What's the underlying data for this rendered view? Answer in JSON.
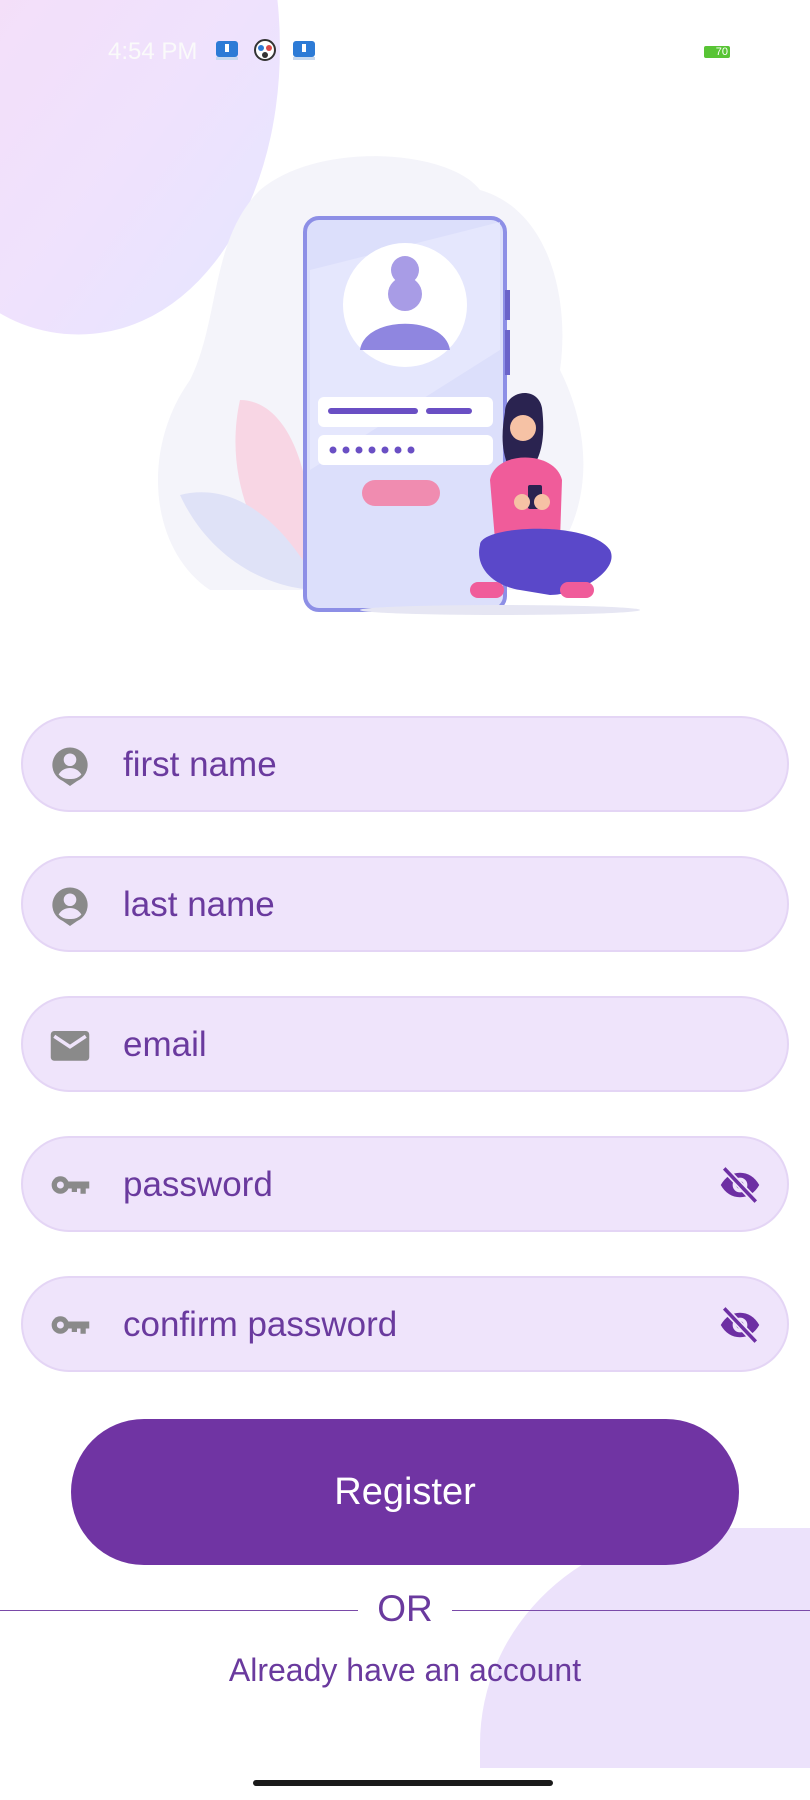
{
  "status_bar": {
    "time": "4:54 PM",
    "battery": "70",
    "icons": [
      "usb-debug-icon",
      "app-notification-icon",
      "usb-debug-icon"
    ]
  },
  "form": {
    "first_name": {
      "placeholder": "first name",
      "icon": "person-icon"
    },
    "last_name": {
      "placeholder": "last name",
      "icon": "person-icon"
    },
    "email": {
      "placeholder": "email",
      "icon": "mail-icon"
    },
    "password": {
      "placeholder": "password",
      "icon": "key-icon",
      "toggle_icon": "eye-off-icon"
    },
    "confirm_password": {
      "placeholder": "confirm password",
      "icon": "key-icon",
      "toggle_icon": "eye-off-icon"
    }
  },
  "actions": {
    "register_label": "Register",
    "or_label": "OR",
    "login_link": "Already have an account"
  },
  "colors": {
    "primary": "#7034a3",
    "field_bg": "#efe4fb",
    "text": "#6a3a9e"
  }
}
